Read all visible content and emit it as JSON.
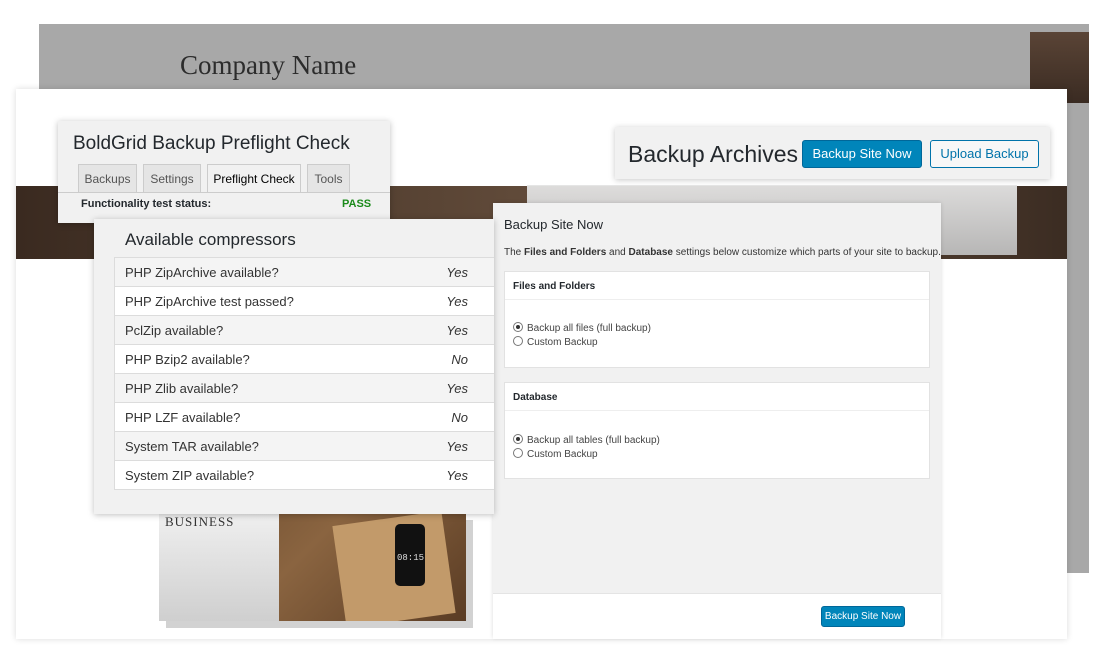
{
  "background_site": {
    "company_name": "Company Name"
  },
  "desk_photo": {
    "newspaper_headline": "BUSINESS",
    "phone_time": "08:15"
  },
  "preflight": {
    "title": "BoldGrid Backup Preflight Check",
    "tabs": [
      {
        "label": "Backups",
        "active": false
      },
      {
        "label": "Settings",
        "active": false
      },
      {
        "label": "Preflight Check",
        "active": true
      },
      {
        "label": "Tools",
        "active": false
      }
    ],
    "status_label": "Functionality test status:",
    "status_value": "PASS",
    "status_color": "#1a8a1a"
  },
  "archives": {
    "title": "Backup Archives",
    "backup_now_label": "Backup Site Now",
    "upload_label": "Upload Backup"
  },
  "compressors": {
    "title": "Available compressors",
    "rows": [
      {
        "name": "PHP ZipArchive available?",
        "value": "Yes"
      },
      {
        "name": "PHP ZipArchive test passed?",
        "value": "Yes"
      },
      {
        "name": "PclZip available?",
        "value": "Yes"
      },
      {
        "name": "PHP Bzip2 available?",
        "value": "No"
      },
      {
        "name": "PHP Zlib available?",
        "value": "Yes"
      },
      {
        "name": "PHP LZF available?",
        "value": "No"
      },
      {
        "name": "System TAR available?",
        "value": "Yes"
      },
      {
        "name": "System ZIP available?",
        "value": "Yes"
      }
    ]
  },
  "backup_site_now": {
    "title": "Backup Site Now",
    "desc_pre": "The ",
    "desc_files": "Files and Folders",
    "desc_mid": " and ",
    "desc_db": "Database",
    "desc_post": " settings below customize which parts of your site to backup.",
    "files": {
      "heading": "Files and Folders",
      "options": [
        {
          "label": "Backup all files (full backup)",
          "selected": true
        },
        {
          "label": "Custom Backup",
          "selected": false
        }
      ]
    },
    "database": {
      "heading": "Database",
      "options": [
        {
          "label": "Backup all tables (full backup)",
          "selected": true
        },
        {
          "label": "Custom Backup",
          "selected": false
        }
      ]
    },
    "submit_label": "Backup Site Now"
  },
  "colors": {
    "primary_button": "#0085ba",
    "link_blue": "#0073aa"
  }
}
